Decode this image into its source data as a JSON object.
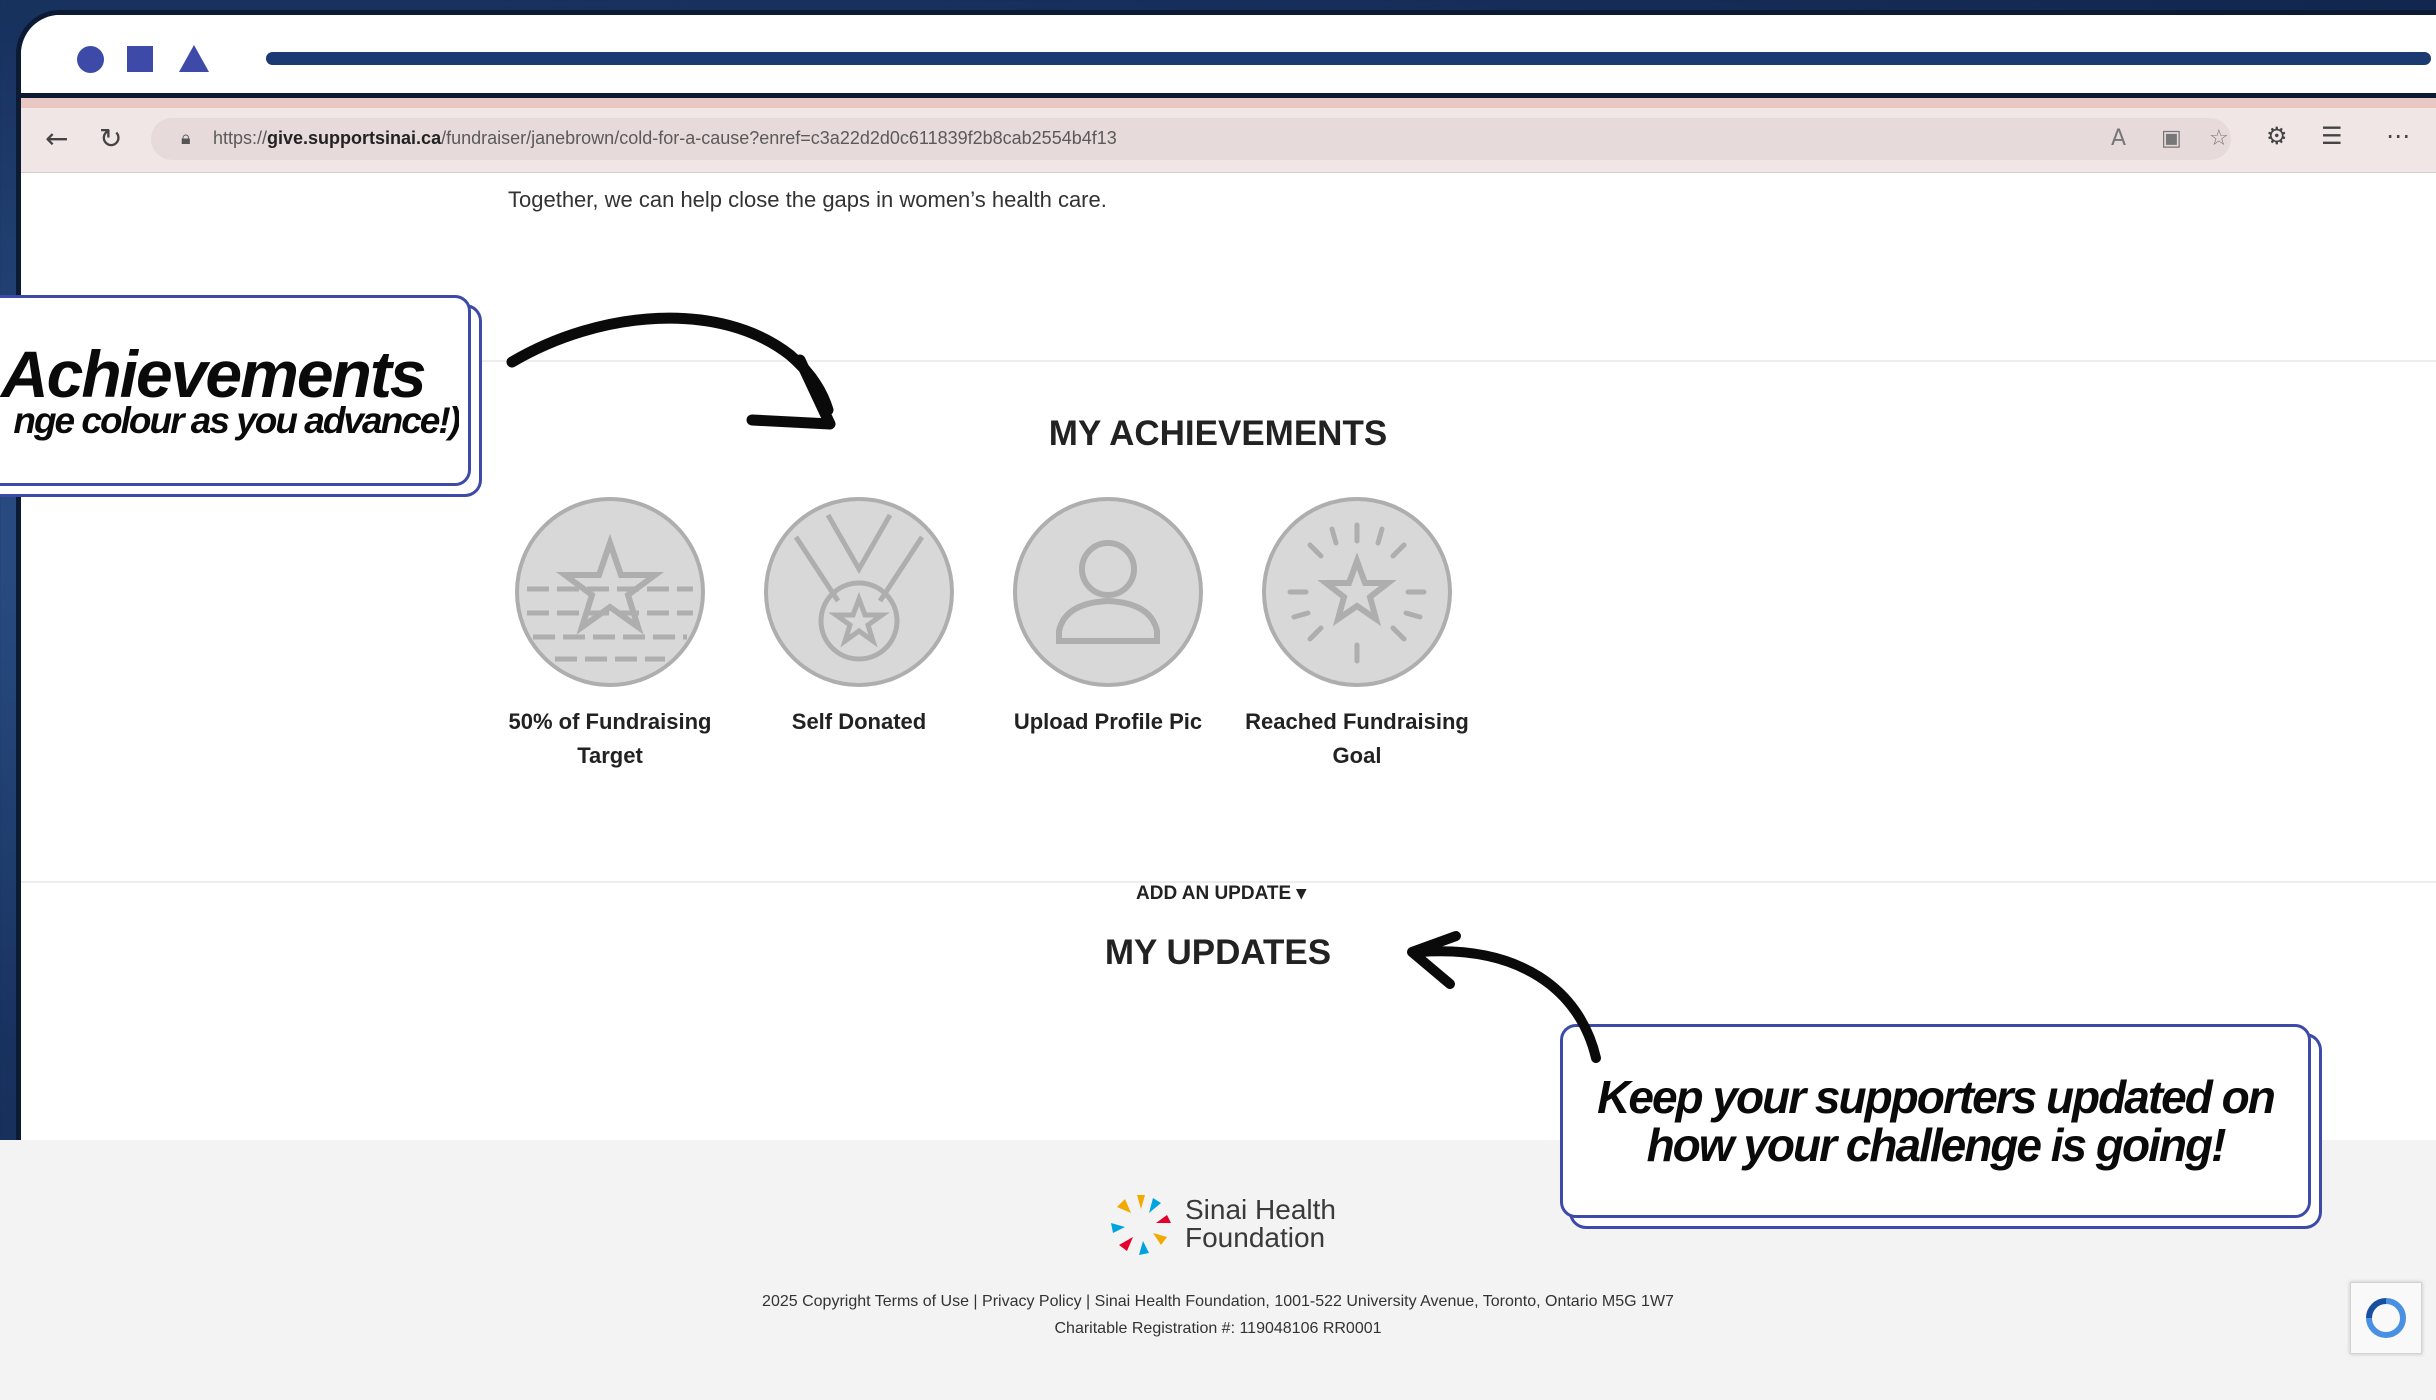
{
  "browser": {
    "url_prefix": "https://",
    "url_host": "give.supportsinai.ca",
    "url_path": "/fundraiser/janebrown/cold-for-a-cause?enref=c3a22d2d0c611839f2b8cab2554b4f13",
    "icons": [
      "back-icon",
      "refresh-icon",
      "lock-icon",
      "read-aloud-icon",
      "immersive-reader-icon",
      "favorite-star-icon",
      "extensions-icon",
      "favorites-icon",
      "more-icon"
    ]
  },
  "page": {
    "intro_text": "Together, we can help close the gaps in women’s health care.",
    "achievements": {
      "title": "MY ACHIEVEMENTS",
      "badges": [
        {
          "label": "50% of Fundraising Target",
          "icon": "star-half-fill-icon"
        },
        {
          "label": "Self Donated",
          "icon": "medal-icon"
        },
        {
          "label": "Upload Profile Pic",
          "icon": "profile-person-icon"
        },
        {
          "label": "Reached Fundraising Goal",
          "icon": "star-burst-icon"
        }
      ]
    },
    "updates": {
      "title": "MY UPDATES",
      "add_update": "ADD AN UPDATE ▾"
    },
    "footer": {
      "logo_line1": "Sinai Health",
      "logo_line2": "Foundation",
      "copyright": "2025 Copyright Terms of Use | Privacy Policy | Sinai Health Foundation, 1001-522 University Avenue, Toronto, Ontario M5G 1W7",
      "registration": "Charitable Registration #: 119048106 RR0001"
    }
  },
  "callouts": {
    "achievements_big": "Achievements",
    "achievements_small": "nge colour as you advance!)",
    "updates": "Keep your supporters updated on how your challenge is going!"
  },
  "colors": {
    "accent": "#3d4aa8",
    "background": "#1b3a72",
    "badge_fill": "#d8d8d8",
    "badge_stroke": "#aeaeae"
  }
}
